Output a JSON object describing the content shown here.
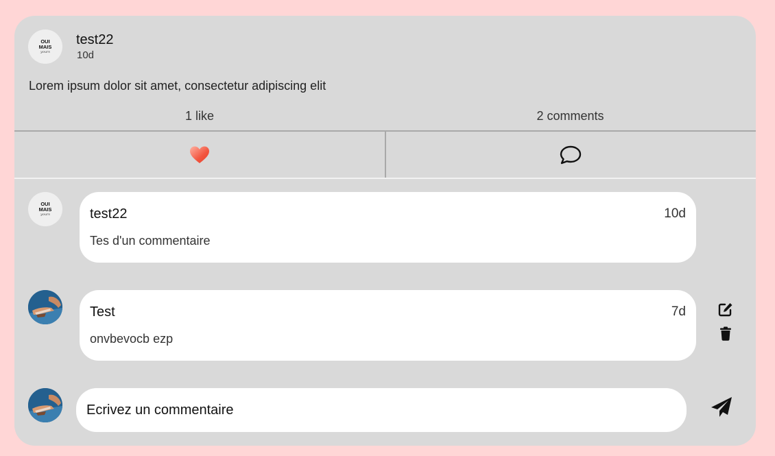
{
  "post": {
    "author": "test22",
    "time": "10d",
    "text": "Lorem ipsum dolor sit amet, consectetur adipiscing elit",
    "avatar_logo_lines": [
      "OUI",
      "MAIS",
      "yours"
    ]
  },
  "stats": {
    "likes": "1 like",
    "comments": "2 comments"
  },
  "actions": {
    "like_icon": "heart-icon",
    "comment_icon": "speech-bubble-icon",
    "like_color": "#f2553f"
  },
  "comments": [
    {
      "author": "test22",
      "time": "10d",
      "text": "Tes d'un commentaire",
      "avatar": "logo",
      "editable": false
    },
    {
      "author": "Test",
      "time": "7d",
      "text": "onvbevocb ezp",
      "avatar": "photo",
      "editable": true,
      "edit_icon": "edit-icon",
      "delete_icon": "trash-icon"
    }
  ],
  "composer": {
    "placeholder": "Ecrivez un commentaire",
    "value": "",
    "send_icon": "send-paper-plane-icon"
  },
  "colors": {
    "page_background": "#ffd6d6",
    "card_background": "#d9d9d9",
    "bubble_background": "#ffffff"
  }
}
